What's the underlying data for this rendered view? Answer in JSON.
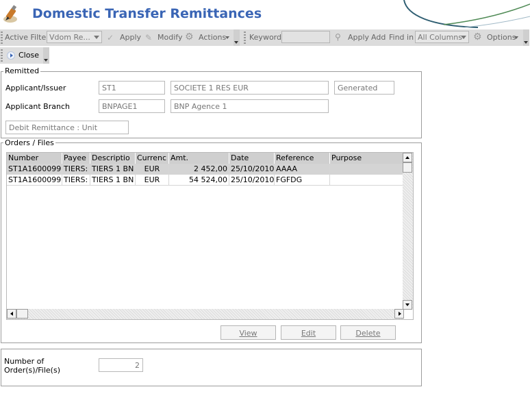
{
  "header": {
    "title": "Domestic Transfer Remittances"
  },
  "toolbar": {
    "active_filter_label": "Active Filter",
    "filter_value": "Vdom Re...",
    "apply_label": "Apply",
    "modify_label": "Modify",
    "actions_label": "Actions",
    "keyword_label": "Keyword",
    "keyword_value": "",
    "apply2_label": "Apply",
    "add_label": "Add",
    "find_in_label": "Find in",
    "find_in_value": "All Columns",
    "options_label": "Options",
    "close_label": "Close"
  },
  "remitted": {
    "section_title": "Remitted",
    "applicant_label": "Applicant/Issuer",
    "applicant_code": "ST1",
    "applicant_name": "SOCIETE 1 RES EUR",
    "status": "Generated",
    "branch_label": "Applicant Branch",
    "branch_code": "BNPAGE1",
    "branch_name": "BNP Agence 1",
    "debit_mode": "Debit Remittance  :  Unit"
  },
  "orders": {
    "section_title": "Orders / Files",
    "columns": [
      "Number",
      "Payee",
      "Descriptio",
      "Currenc",
      "Amt.",
      "Date",
      "Reference",
      "Purpose"
    ],
    "rows": [
      [
        "ST1A1600099",
        "TIERS:",
        "TIERS 1 BN",
        "EUR",
        "2 452,00",
        "25/10/2010",
        "AAAA",
        ""
      ],
      [
        "ST1A1600099",
        "TIERS:",
        "TIERS 1 BN",
        "EUR",
        "54 524,00",
        "25/10/2010",
        "FGFDG",
        ""
      ]
    ],
    "view_label": "View",
    "edit_label": "Edit",
    "delete_label": "Delete"
  },
  "summary": {
    "count_label_line1": "Number of",
    "count_label_line2": "Order(s)/File(s)",
    "count_value": "2"
  },
  "colors": {
    "title": "#3a65b5",
    "toolbar_bg": "#dcdcdc",
    "selected_row": "#d4d4d4",
    "grid_header": "#cfcfcf"
  }
}
